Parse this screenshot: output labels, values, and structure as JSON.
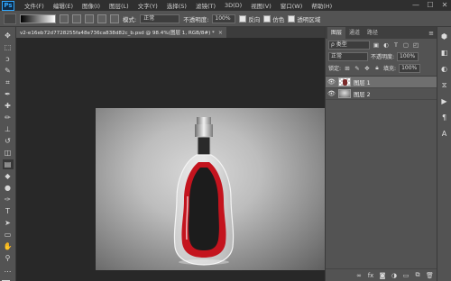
{
  "app": {
    "logo": "Ps"
  },
  "menu": [
    "文件(F)",
    "编辑(E)",
    "图像(I)",
    "图层(L)",
    "文字(Y)",
    "选择(S)",
    "滤镜(T)",
    "3D(D)",
    "视图(V)",
    "窗口(W)",
    "帮助(H)"
  ],
  "window_controls": {
    "minimize": "—",
    "maximize": "☐",
    "close": "✕"
  },
  "options": {
    "mode_label": "模式:",
    "mode_value": "正常",
    "opacity_label": "不透明度:",
    "opacity_value": "100%",
    "reverse_label": "反向",
    "dither_label": "仿色",
    "transparency_label": "透明区域"
  },
  "document": {
    "tab_title": "v2-e16eb72d7728255fa48e736ca838d82c_b.psd @ 98.4%(图层 1, RGB/8#) *",
    "close": "×"
  },
  "tools": [
    {
      "icon": "move-icon",
      "glyph": "✥"
    },
    {
      "icon": "marquee-icon",
      "glyph": "⬚"
    },
    {
      "icon": "lasso-icon",
      "glyph": "ↄ"
    },
    {
      "icon": "quick-select-icon",
      "glyph": "✎"
    },
    {
      "icon": "crop-icon",
      "glyph": "⌗"
    },
    {
      "icon": "eyedropper-icon",
      "glyph": "✒"
    },
    {
      "icon": "healing-icon",
      "glyph": "✚"
    },
    {
      "icon": "brush-icon",
      "glyph": "✏"
    },
    {
      "icon": "stamp-icon",
      "glyph": "⊥"
    },
    {
      "icon": "history-brush-icon",
      "glyph": "↺"
    },
    {
      "icon": "eraser-icon",
      "glyph": "◫"
    },
    {
      "icon": "gradient-icon",
      "glyph": "▤"
    },
    {
      "icon": "blur-icon",
      "glyph": "◆"
    },
    {
      "icon": "dodge-icon",
      "glyph": "●"
    },
    {
      "icon": "pen-icon",
      "glyph": "✑"
    },
    {
      "icon": "type-icon",
      "glyph": "T"
    },
    {
      "icon": "path-select-icon",
      "glyph": "➤"
    },
    {
      "icon": "shape-icon",
      "glyph": "▭"
    },
    {
      "icon": "hand-icon",
      "glyph": "✋"
    },
    {
      "icon": "zoom-icon",
      "glyph": "⚲"
    },
    {
      "icon": "more-tools-icon",
      "glyph": "…"
    }
  ],
  "colors": {
    "foreground": "#000000",
    "background": "#ffffff"
  },
  "panel": {
    "tabs": [
      "图层",
      "通道",
      "路径"
    ],
    "kind_label": "ρ 类型",
    "blend_mode": "正常",
    "opacity_label": "不透明度:",
    "opacity_value": "100%",
    "lock_label": "锁定:",
    "fill_label": "填充:",
    "fill_value": "100%",
    "layers": [
      {
        "name": "图层 1",
        "selected": true
      },
      {
        "name": "图层 2",
        "selected": false
      }
    ],
    "footer_icons": [
      "link-icon",
      "fx-icon",
      "mask-icon",
      "adjustment-icon",
      "group-icon",
      "new-layer-icon",
      "trash-icon"
    ]
  }
}
